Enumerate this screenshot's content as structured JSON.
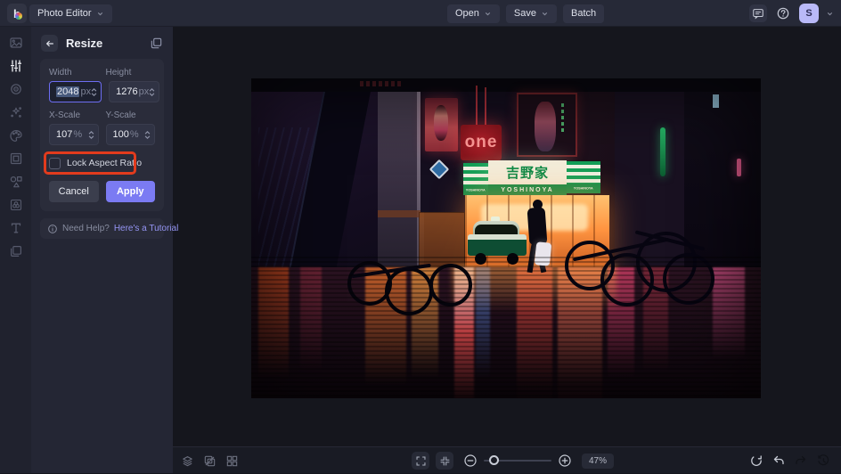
{
  "app": {
    "logo_letter": "b",
    "title": "Photo Editor"
  },
  "topbar": {
    "open_label": "Open",
    "save_label": "Save",
    "batch_label": "Batch",
    "avatar_letter": "S",
    "icons": [
      "feedback-message-icon",
      "help-icon",
      "account-avatar"
    ]
  },
  "sidebar": {
    "icons": [
      "image-manager-icon",
      "edit-sliders-icon",
      "touchup-icon",
      "effects-sparkle-icon",
      "artsy-palette-icon",
      "frames-icon",
      "graphics-shapes-icon",
      "overlays-icon",
      "text-icon",
      "layers-icon"
    ],
    "active_index": 1
  },
  "panel": {
    "title": "Resize",
    "width_label": "Width",
    "height_label": "Height",
    "width_value": "2048",
    "height_value": "1276",
    "px_unit": "px",
    "xscale_label": "X-Scale",
    "yscale_label": "Y-Scale",
    "xscale_value": "107",
    "yscale_value": "100",
    "percent_unit": "%",
    "lock_label": "Lock Aspect Ratio",
    "lock_checked": false,
    "cancel_label": "Cancel",
    "apply_label": "Apply",
    "help_prefix": "Need Help?",
    "help_link": "Here's a Tutorial"
  },
  "photo": {
    "one_sign_text": "one",
    "yoshinoya_cjk": "吉野家",
    "yoshinoya_latin": "YOSHINOYA"
  },
  "bottombar": {
    "zoom_level": "47%",
    "left_icons": [
      "layers-stack-icon",
      "compare-icon",
      "grid-view-icon"
    ],
    "center_icons": [
      "fullscreen-icon",
      "fit-screen-icon",
      "zoom-out-icon",
      "zoom-in-icon"
    ],
    "right_icons": [
      "reset-icon",
      "undo-icon",
      "redo-icon",
      "history-icon"
    ]
  },
  "colors": {
    "accent_purple": "#7b7bf3",
    "annotation_red": "#e23b1d",
    "avatar_lavender": "#b9b9f8",
    "input_focus_border": "#6d6df2",
    "yoshinoya_green": "#0e8c4a",
    "one_sign_red": "#b2202a",
    "topbar_bg": "#262937",
    "panel_bg": "#242634",
    "canvas_bg": "#15161d"
  }
}
